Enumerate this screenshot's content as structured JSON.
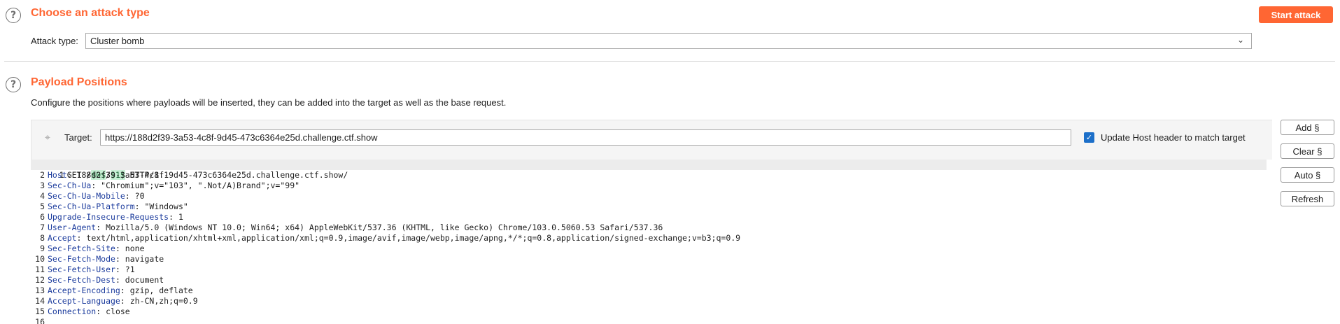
{
  "attack_section": {
    "title": "Choose an attack type",
    "attack_type_label": "Attack type:",
    "attack_type_value": "Cluster bomb",
    "start_attack_label": "Start attack"
  },
  "payload_section": {
    "title": "Payload Positions",
    "description": "Configure the positions where payloads will be inserted, they can be added into the target as well as the base request.",
    "target_label": "Target:",
    "target_value": "https://188d2f39-3a53-4c8f-9d45-473c6364e25d.challenge.ctf.show",
    "update_host_label": "Update Host header to match target",
    "update_host_checked": true
  },
  "side_buttons": {
    "add": "Add §",
    "clear": "Clear §",
    "auto": "Auto §",
    "refresh": "Refresh"
  },
  "request": {
    "line1": {
      "pre": "GET /",
      "p1": "$0$",
      "mid": "/",
      "p2": "$1$",
      "post": " HTTP/1.1"
    },
    "headers": [
      {
        "name": "Host",
        "value": "188d2f39-3a53-4c8f-9d45-473c6364e25d.challenge.ctf.show/"
      },
      {
        "name": "Sec-Ch-Ua",
        "value": "\"Chromium\";v=\"103\", \".Not/A)Brand\";v=\"99\""
      },
      {
        "name": "Sec-Ch-Ua-Mobile",
        "value": "?0"
      },
      {
        "name": "Sec-Ch-Ua-Platform",
        "value": "\"Windows\""
      },
      {
        "name": "Upgrade-Insecure-Requests",
        "value": "1"
      },
      {
        "name": "User-Agent",
        "value": "Mozilla/5.0 (Windows NT 10.0; Win64; x64) AppleWebKit/537.36 (KHTML, like Gecko) Chrome/103.0.5060.53 Safari/537.36"
      },
      {
        "name": "Accept",
        "value": "text/html,application/xhtml+xml,application/xml;q=0.9,image/avif,image/webp,image/apng,*/*;q=0.8,application/signed-exchange;v=b3;q=0.9"
      },
      {
        "name": "Sec-Fetch-Site",
        "value": "none"
      },
      {
        "name": "Sec-Fetch-Mode",
        "value": "navigate"
      },
      {
        "name": "Sec-Fetch-User",
        "value": "?1"
      },
      {
        "name": "Sec-Fetch-Dest",
        "value": "document"
      },
      {
        "name": "Accept-Encoding",
        "value": "gzip, deflate"
      },
      {
        "name": "Accept-Language",
        "value": "zh-CN,zh;q=0.9"
      },
      {
        "name": "Connection",
        "value": "close"
      }
    ],
    "line_numbers": [
      "1",
      "2",
      "3",
      "4",
      "5",
      "6",
      "7",
      "8",
      "9",
      "10",
      "11",
      "12",
      "13",
      "14",
      "15",
      "16"
    ]
  },
  "icons": {
    "help": "help-circle-icon",
    "target": "crosshair-icon",
    "dropdown": "chevron-down-icon",
    "checkbox": "checkmark-icon"
  },
  "colors": {
    "accent": "#ff6633",
    "checkbox": "#1c6fc9",
    "header_name": "#1a3a9c",
    "payload_bg": "#c9efd5"
  }
}
